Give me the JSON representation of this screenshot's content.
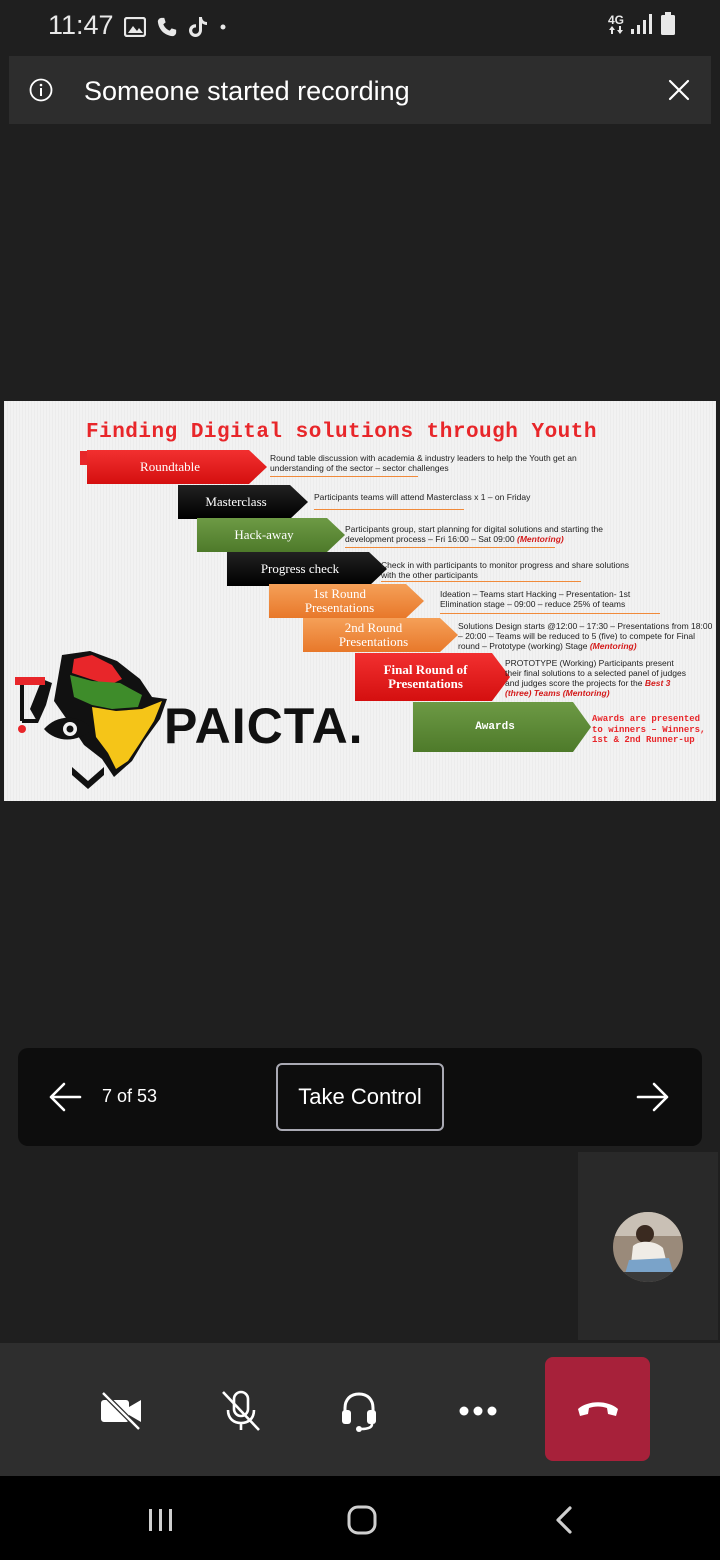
{
  "status_bar": {
    "time": "11:47",
    "network": "4G",
    "icons": [
      "gallery-icon",
      "phone-icon",
      "tiktok-icon",
      "dot-icon",
      "signal-icon",
      "battery-icon"
    ]
  },
  "banner": {
    "text": "Someone started recording",
    "info_icon": "info-icon",
    "close_icon": "close-icon"
  },
  "slide": {
    "title": "Finding Digital solutions through Youth",
    "steps": [
      {
        "label": "Roundtable",
        "description": "Round table discussion with academia & industry leaders to help the Youth get an understanding of the sector – sector challenges"
      },
      {
        "label": "Masterclass",
        "description": "Participants teams will attend Masterclass x 1 – on Friday"
      },
      {
        "label": "Hack-away",
        "description": "Participants group, start planning for digital solutions and starting the development process – Fri 16:00 – Sat 09:00",
        "highlight": "(Mentoring)"
      },
      {
        "label": "Progress check",
        "description": "Check in with participants to monitor progress and share solutions with the other participants"
      },
      {
        "label_line1": "1st Round",
        "label_line2": "Presentations",
        "description": "Ideation – Teams start Hacking – Presentation- 1st Elimination stage – 09:00 – reduce 25% of teams"
      },
      {
        "label_line1": "2nd Round",
        "label_line2": "Presentations",
        "description": "Solutions Design starts @12:00 – 17:30 – Presentations from 18:00 – 20:00 – Teams will be reduced to 5 (five) to compete for Final round – Prototype (working) Stage",
        "highlight": "(Mentoring)"
      },
      {
        "label_line1": "Final Round of",
        "label_line2": "Presentations",
        "description": "PROTOTYPE (Working) Participants present their final solutions to a selected panel of judges and judges score the projects for the",
        "highlight": "Best 3 (three) Teams (Mentoring)"
      },
      {
        "label": "Awards",
        "description": "Awards are presented to winners – Winners, 1st & 2nd Runner-up"
      }
    ],
    "logo_text": "PAICTA."
  },
  "presenter_controls": {
    "page_indicator": "7 of 53",
    "take_control_label": "Take Control",
    "prev_icon": "arrow-left-icon",
    "next_icon": "arrow-right-icon"
  },
  "call_controls": {
    "buttons": [
      "video-off-icon",
      "mic-off-icon",
      "headset-icon",
      "more-icon",
      "hangup-icon"
    ],
    "hangup_color": "#a7213a"
  },
  "nav_bar": {
    "buttons": [
      "recents-icon",
      "home-icon",
      "back-icon"
    ]
  }
}
